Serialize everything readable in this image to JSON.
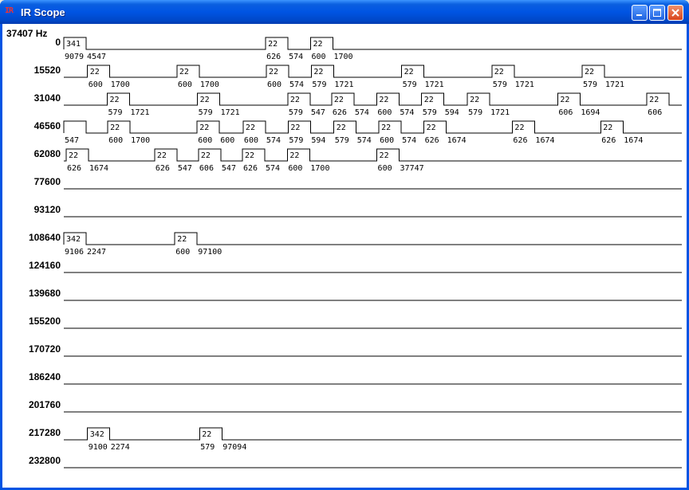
{
  "window": {
    "title": "IR Scope",
    "icon": "IR",
    "controls": {
      "minimize": "minimize",
      "maximize": "maximize",
      "close": "close"
    }
  },
  "frequency_label": "37407 Hz",
  "rows": [
    {
      "offset": "0",
      "events": [
        {
          "type": "pulse",
          "width": 341,
          "top": "341",
          "bottom": "9079"
        },
        {
          "type": "space",
          "width": 4547,
          "bottom": "4547"
        },
        {
          "type": "pulse",
          "width": 22,
          "top": "22",
          "bottom": "626"
        },
        {
          "type": "space",
          "width": 574,
          "bottom": "574"
        },
        {
          "type": "pulse",
          "width": 22,
          "top": "22",
          "bottom": "600"
        },
        {
          "type": "space",
          "width": 1700,
          "bottom": "1700"
        }
      ]
    },
    {
      "offset": "15520",
      "events": [
        {
          "type": "space",
          "width": 600
        },
        {
          "type": "pulse",
          "width": 22,
          "top": "22",
          "bottom": "600"
        },
        {
          "type": "space",
          "width": 1700,
          "bottom": "1700"
        },
        {
          "type": "pulse",
          "width": 22,
          "top": "22",
          "bottom": "600"
        },
        {
          "type": "space",
          "width": 1700,
          "bottom": "1700"
        },
        {
          "type": "pulse",
          "width": 22,
          "top": "22",
          "bottom": "600"
        },
        {
          "type": "space",
          "width": 574,
          "bottom": "574"
        },
        {
          "type": "pulse",
          "width": 22,
          "top": "22",
          "bottom": "579"
        },
        {
          "type": "space",
          "width": 1721,
          "bottom": "1721"
        },
        {
          "type": "pulse",
          "width": 22,
          "top": "22",
          "bottom": "579"
        },
        {
          "type": "space",
          "width": 1721,
          "bottom": "1721"
        },
        {
          "type": "pulse",
          "width": 22,
          "top": "22",
          "bottom": "579"
        },
        {
          "type": "space",
          "width": 1721,
          "bottom": "1721"
        },
        {
          "type": "pulse",
          "width": 22,
          "top": "22",
          "bottom": "579"
        },
        {
          "type": "space",
          "width": 1721,
          "bottom": "1721"
        }
      ]
    },
    {
      "offset": "31040",
      "events": [
        {
          "type": "space",
          "width": 1100
        },
        {
          "type": "pulse",
          "width": 22,
          "top": "22",
          "bottom": "579"
        },
        {
          "type": "space",
          "width": 1721,
          "bottom": "1721"
        },
        {
          "type": "pulse",
          "width": 22,
          "top": "22",
          "bottom": "579"
        },
        {
          "type": "space",
          "width": 1721,
          "bottom": "1721"
        },
        {
          "type": "pulse",
          "width": 22,
          "top": "22",
          "bottom": "579"
        },
        {
          "type": "space",
          "width": 547,
          "bottom": "547"
        },
        {
          "type": "pulse",
          "width": 22,
          "top": "22",
          "bottom": "626"
        },
        {
          "type": "space",
          "width": 574,
          "bottom": "574"
        },
        {
          "type": "pulse",
          "width": 22,
          "top": "22",
          "bottom": "600"
        },
        {
          "type": "space",
          "width": 574,
          "bottom": "574"
        },
        {
          "type": "pulse",
          "width": 22,
          "top": "22",
          "bottom": "579"
        },
        {
          "type": "space",
          "width": 594,
          "bottom": "594"
        },
        {
          "type": "pulse",
          "width": 22,
          "top": "22",
          "bottom": "579"
        },
        {
          "type": "space",
          "width": 1721,
          "bottom": "1721"
        },
        {
          "type": "pulse",
          "width": 22,
          "top": "22",
          "bottom": "606"
        },
        {
          "type": "space",
          "width": 1694,
          "bottom": "1694"
        },
        {
          "type": "pulse",
          "width": 22,
          "top": "22",
          "bottom": "606"
        }
      ]
    },
    {
      "offset": "46560",
      "events": [
        {
          "type": "pulse",
          "width": 22,
          "bottom": "547"
        },
        {
          "type": "space",
          "width": 547
        },
        {
          "type": "pulse",
          "width": 22,
          "top": "22",
          "bottom": "600"
        },
        {
          "type": "space",
          "width": 1700,
          "bottom": "1700"
        },
        {
          "type": "pulse",
          "width": 22,
          "top": "22",
          "bottom": "600"
        },
        {
          "type": "space",
          "width": 600,
          "bottom": "600"
        },
        {
          "type": "pulse",
          "width": 22,
          "top": "22",
          "bottom": "600"
        },
        {
          "type": "space",
          "width": 574,
          "bottom": "574"
        },
        {
          "type": "pulse",
          "width": 22,
          "top": "22",
          "bottom": "579"
        },
        {
          "type": "space",
          "width": 594,
          "bottom": "594"
        },
        {
          "type": "pulse",
          "width": 22,
          "top": "22",
          "bottom": "579"
        },
        {
          "type": "space",
          "width": 574,
          "bottom": "574"
        },
        {
          "type": "pulse",
          "width": 22,
          "top": "22",
          "bottom": "600"
        },
        {
          "type": "space",
          "width": 574,
          "bottom": "574"
        },
        {
          "type": "pulse",
          "width": 22,
          "top": "22",
          "bottom": "626"
        },
        {
          "type": "space",
          "width": 1674,
          "bottom": "1674"
        },
        {
          "type": "pulse",
          "width": 22,
          "top": "22",
          "bottom": "626"
        },
        {
          "type": "space",
          "width": 1674,
          "bottom": "1674"
        },
        {
          "type": "pulse",
          "width": 22,
          "top": "22",
          "bottom": "626"
        },
        {
          "type": "space",
          "width": 1674,
          "bottom": "1674"
        }
      ]
    },
    {
      "offset": "62080",
      "events": [
        {
          "type": "space",
          "width": 60
        },
        {
          "type": "pulse",
          "width": 22,
          "top": "22",
          "bottom": "626"
        },
        {
          "type": "space",
          "width": 1674,
          "bottom": "1674"
        },
        {
          "type": "pulse",
          "width": 22,
          "top": "22",
          "bottom": "626"
        },
        {
          "type": "space",
          "width": 547,
          "bottom": "547"
        },
        {
          "type": "pulse",
          "width": 22,
          "top": "22",
          "bottom": "606"
        },
        {
          "type": "space",
          "width": 547,
          "bottom": "547"
        },
        {
          "type": "pulse",
          "width": 22,
          "top": "22",
          "bottom": "626"
        },
        {
          "type": "space",
          "width": 574,
          "bottom": "574"
        },
        {
          "type": "pulse",
          "width": 22,
          "top": "22",
          "bottom": "600"
        },
        {
          "type": "space",
          "width": 1700,
          "bottom": "1700"
        },
        {
          "type": "pulse",
          "width": 22,
          "top": "22",
          "bottom": "600"
        },
        {
          "type": "space",
          "width": 37747,
          "bottom": "37747"
        }
      ]
    },
    {
      "offset": "77600",
      "events": []
    },
    {
      "offset": "93120",
      "events": []
    },
    {
      "offset": "108640",
      "events": [
        {
          "type": "pulse",
          "width": 342,
          "top": "342",
          "bottom": "9106"
        },
        {
          "type": "space",
          "width": 2247,
          "bottom": "2247"
        },
        {
          "type": "pulse",
          "width": 22,
          "top": "22",
          "bottom": "600"
        },
        {
          "type": "space",
          "width": 97100,
          "bottom": "97100"
        }
      ]
    },
    {
      "offset": "124160",
      "events": []
    },
    {
      "offset": "139680",
      "events": []
    },
    {
      "offset": "155200",
      "events": []
    },
    {
      "offset": "170720",
      "events": []
    },
    {
      "offset": "186240",
      "events": []
    },
    {
      "offset": "201760",
      "events": []
    },
    {
      "offset": "217280",
      "events": [
        {
          "type": "space",
          "width": 600
        },
        {
          "type": "pulse",
          "width": 342,
          "top": "342",
          "bottom": "9100"
        },
        {
          "type": "space",
          "width": 2274,
          "bottom": "2274"
        },
        {
          "type": "pulse",
          "width": 22,
          "top": "22",
          "bottom": "579"
        },
        {
          "type": "space",
          "width": 97094,
          "bottom": "97094"
        }
      ]
    },
    {
      "offset": "232800",
      "events": []
    }
  ],
  "colors": {
    "trace": "#000000",
    "background": "#ffffff",
    "titlebar": "#0054e3"
  }
}
